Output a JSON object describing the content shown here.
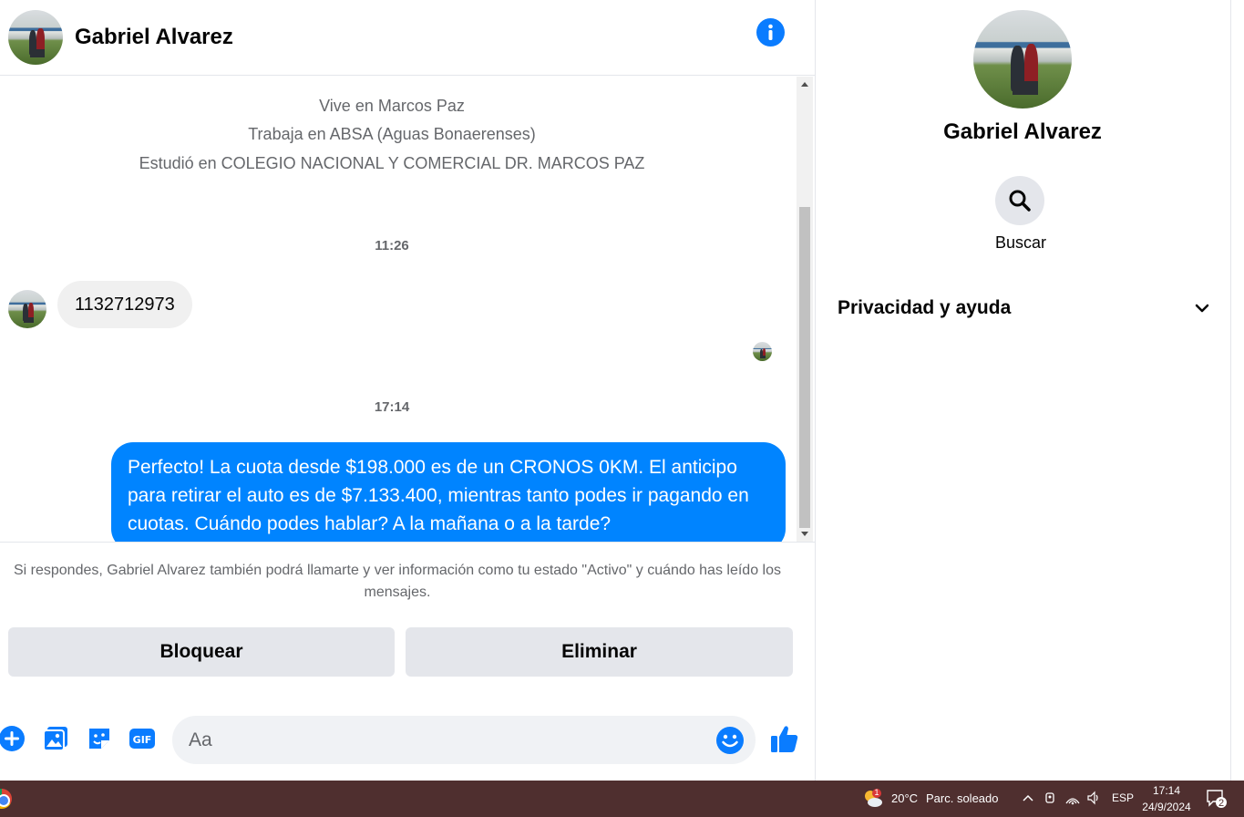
{
  "chat": {
    "contact_name": "Gabriel Alvarez",
    "bio": [
      "Vive en Marcos Paz",
      "Trabaja en ABSA (Aguas Bonaerenses)",
      "Estudió en COLEGIO NACIONAL Y COMERCIAL DR. MARCOS PAZ"
    ],
    "messages": [
      {
        "timestamp": "11:26",
        "direction": "incoming",
        "text": "1132712973"
      },
      {
        "timestamp": "17:14",
        "direction": "outgoing",
        "text": "Perfecto! La cuota desde $198.000 es de un CRONOS 0KM. El anticipo para retirar el auto es de $7.133.400, mientras tanto podes ir pagando en cuotas. Cuándo podes hablar? A la mañana o a la tarde?"
      }
    ],
    "notice": "Si respondes, Gabriel Alvarez también podrá llamarte y ver información como tu estado \"Activo\" y cuándo has leído los mensajes.",
    "block_label": "Bloquear",
    "delete_label": "Eliminar",
    "composer_placeholder": "Aa",
    "accent_color": "#0084ff"
  },
  "info_panel": {
    "name": "Gabriel Alvarez",
    "search_label": "Buscar",
    "privacy_label": "Privacidad y ayuda"
  },
  "taskbar": {
    "weather_temp": "20°C",
    "weather_desc": "Parc. soleado",
    "weather_badge": "1",
    "language": "ESP",
    "time": "17:14",
    "date": "24/9/2024",
    "notification_count": "2"
  }
}
